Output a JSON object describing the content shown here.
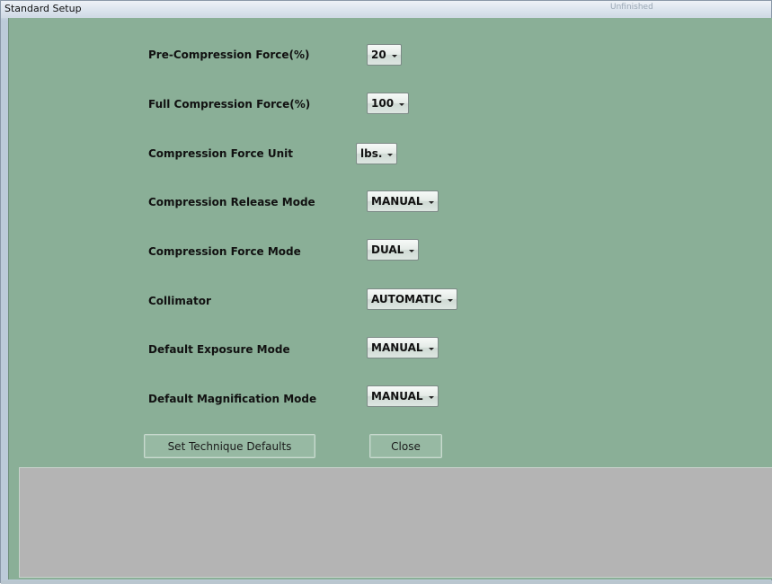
{
  "window": {
    "title": "Standard Setup",
    "faint_title_text": "Unfinished"
  },
  "settings": [
    {
      "label": "Pre-Compression Force(%)",
      "value": "20"
    },
    {
      "label": "Full Compression Force(%)",
      "value": "100"
    },
    {
      "label": "Compression Force Unit",
      "value": "lbs."
    },
    {
      "label": "Compression Release Mode",
      "value": "MANUAL"
    },
    {
      "label": "Compression Force Mode",
      "value": "DUAL"
    },
    {
      "label": "Collimator",
      "value": "AUTOMATIC"
    },
    {
      "label": "Default Exposure Mode",
      "value": "MANUAL"
    },
    {
      "label": "Default Magnification Mode",
      "value": "MANUAL"
    }
  ],
  "buttons": {
    "set_defaults": "Set Technique Defaults",
    "close": "Close"
  },
  "colors": {
    "client_background": "#8aaf97",
    "status_panel": "#b4b4b4"
  }
}
